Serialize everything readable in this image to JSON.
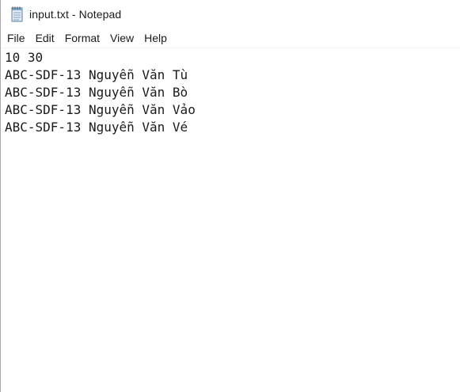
{
  "window": {
    "title": "input.txt - Notepad",
    "icon": "notepad-icon"
  },
  "menu": {
    "items": [
      "File",
      "Edit",
      "Format",
      "View",
      "Help"
    ]
  },
  "document": {
    "lines": [
      "10 30",
      "ABC-SDF-13 Nguyễn Văn Tù",
      "ABC-SDF-13 Nguyễn Văn Bò",
      "ABC-SDF-13 Nguyễn Văn Vảo",
      "ABC-SDF-13 Nguyễn Văn Vé"
    ]
  }
}
